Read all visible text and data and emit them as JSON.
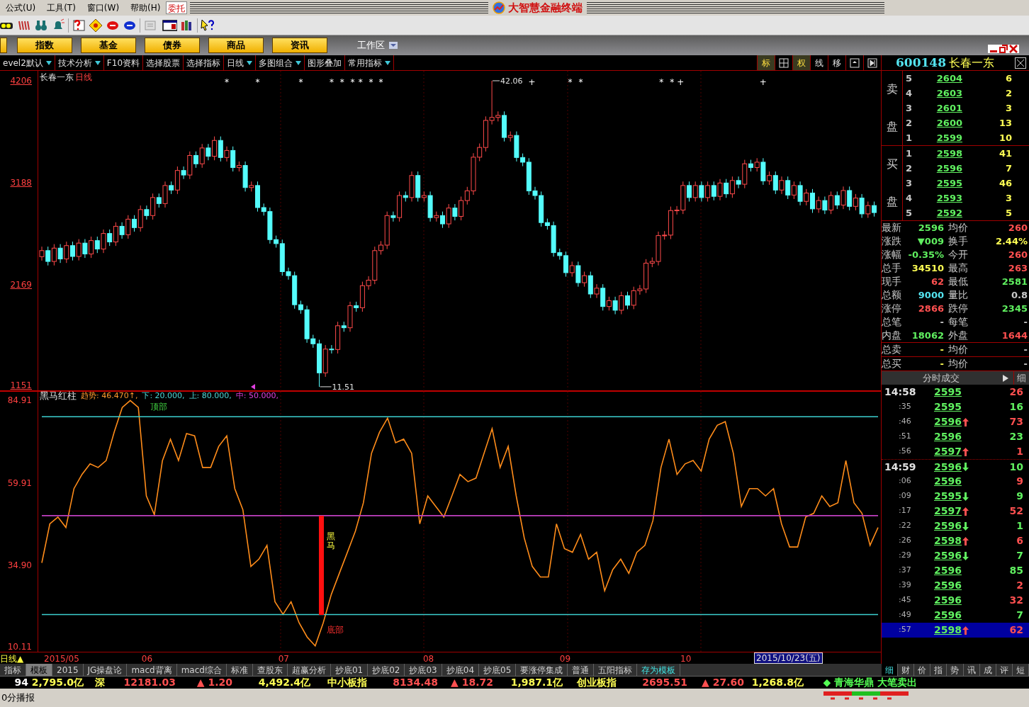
{
  "menu": [
    "公式(U)",
    "工具(T)",
    "窗口(W)",
    "帮助(H)"
  ],
  "entrust_button": "委托",
  "window_title": "大智慧金融终端",
  "market_buttons": [
    "指数",
    "基金",
    "债券",
    "商品",
    "资讯"
  ],
  "workspace": "工作区",
  "tool_row": [
    {
      "label": "evel2默认",
      "dropdown": true
    },
    {
      "label": "技术分析",
      "dropdown": true
    },
    {
      "label": "F10资料",
      "dropdown": false
    },
    {
      "label": "选择股票",
      "dropdown": false
    },
    {
      "label": "选择指标",
      "dropdown": false
    },
    {
      "label": "日线",
      "dropdown": true
    },
    {
      "label": "多图组合",
      "dropdown": true
    },
    {
      "label": "图形叠加",
      "dropdown": false
    },
    {
      "label": "常用指标",
      "dropdown": true
    }
  ],
  "chart_tools": [
    {
      "label": "标",
      "selected": true
    },
    {
      "label": "权",
      "selected": true
    },
    {
      "label": "线",
      "selected": false
    },
    {
      "label": "移",
      "selected": false
    }
  ],
  "stock": {
    "code": "600148",
    "name": "长春一东"
  },
  "price_chart": {
    "stock_name": "长春一东",
    "period": "日线",
    "high_label": "42.06",
    "low_label": "11.51",
    "markers": [
      "*",
      "*",
      "*",
      "*",
      "*",
      "*",
      "*",
      "*",
      "*",
      "+",
      "*",
      "*",
      "*",
      "*",
      "+",
      "+"
    ],
    "chart_data": {
      "type": "candlestick",
      "ylim": [
        1101,
        4305
      ],
      "yticks": [
        {
          "value": 4206,
          "label": "4206"
        },
        {
          "value": 3188,
          "label": "3188"
        },
        {
          "value": 2169,
          "label": "2169"
        },
        {
          "value": 1151,
          "label": "1151"
        }
      ],
      "ohlc": [
        [
          2450,
          2550,
          2410,
          2510
        ],
        [
          2510,
          2550,
          2362,
          2402
        ],
        [
          2402,
          2575,
          2362,
          2535
        ],
        [
          2535,
          2575,
          2387,
          2427
        ],
        [
          2427,
          2600,
          2387,
          2560
        ],
        [
          2560,
          2600,
          2412,
          2452
        ],
        [
          2452,
          2625,
          2412,
          2585
        ],
        [
          2585,
          2625,
          2437,
          2477
        ],
        [
          2477,
          2650,
          2437,
          2610
        ],
        [
          2610,
          2650,
          2486,
          2526
        ],
        [
          2526,
          2721,
          2486,
          2681
        ],
        [
          2681,
          2721,
          2557,
          2597
        ],
        [
          2597,
          2793,
          2557,
          2753
        ],
        [
          2753,
          2793,
          2629,
          2669
        ],
        [
          2669,
          2864,
          2629,
          2824
        ],
        [
          2824,
          2864,
          2700,
          2740
        ],
        [
          2740,
          2960,
          2700,
          2920
        ],
        [
          2920,
          2960,
          2820,
          2860
        ],
        [
          2860,
          3080,
          2820,
          3040
        ],
        [
          3040,
          3080,
          2940,
          2980
        ],
        [
          2980,
          3200,
          2940,
          3160
        ],
        [
          3160,
          3200,
          3075,
          3115
        ],
        [
          3115,
          3350,
          3075,
          3310
        ],
        [
          3310,
          3350,
          3225,
          3265
        ],
        [
          3265,
          3500,
          3225,
          3460
        ],
        [
          3460,
          3500,
          3337,
          3377
        ],
        [
          3377,
          3575,
          3337,
          3535
        ],
        [
          3535,
          3575,
          3412,
          3452
        ],
        [
          3452,
          3650,
          3412,
          3610
        ],
        [
          3610,
          3650,
          3400,
          3440
        ],
        [
          3440,
          3550,
          3400,
          3510
        ],
        [
          3510,
          3550,
          3300,
          3340
        ],
        [
          3340,
          3400,
          3300,
          3360
        ],
        [
          3360,
          3400,
          3100,
          3140
        ],
        [
          3140,
          3200,
          3100,
          3160
        ],
        [
          3160,
          3200,
          2900,
          2940
        ],
        [
          2940,
          2980,
          2860,
          2900
        ],
        [
          2900,
          2940,
          2580,
          2620
        ],
        [
          2620,
          2660,
          2540,
          2580
        ],
        [
          2580,
          2620,
          2260,
          2300
        ],
        [
          2300,
          2340,
          2220,
          2260
        ],
        [
          2260,
          2300,
          1930,
          1970
        ],
        [
          1970,
          2010,
          1880,
          1920
        ],
        [
          1920,
          1960,
          1590,
          1630
        ],
        [
          1630,
          1670,
          1540,
          1580
        ],
        [
          1580,
          1620,
          1151,
          1290
        ],
        [
          1290,
          1567,
          1250,
          1527
        ],
        [
          1527,
          1567,
          1483,
          1523
        ],
        [
          1523,
          1800,
          1483,
          1760
        ],
        [
          1760,
          1800,
          1700,
          1740
        ],
        [
          1740,
          2000,
          1700,
          1960
        ],
        [
          1960,
          2000,
          1900,
          1940
        ],
        [
          1940,
          2200,
          1900,
          2160
        ],
        [
          2160,
          2255,
          2120,
          2215
        ],
        [
          2215,
          2550,
          2175,
          2510
        ],
        [
          2510,
          2605,
          2470,
          2565
        ],
        [
          2565,
          2900,
          2525,
          2860
        ],
        [
          2860,
          2900,
          2800,
          2840
        ],
        [
          2840,
          3100,
          2800,
          3060
        ],
        [
          3060,
          3100,
          3000,
          3040
        ],
        [
          3040,
          3300,
          3000,
          3260
        ],
        [
          3260,
          3300,
          3000,
          3040
        ],
        [
          3040,
          3100,
          3000,
          3060
        ],
        [
          3060,
          3100,
          2800,
          2840
        ],
        [
          2840,
          2900,
          2800,
          2860
        ],
        [
          2860,
          2900,
          2737,
          2777
        ],
        [
          2777,
          2975,
          2737,
          2935
        ],
        [
          2935,
          2975,
          2812,
          2852
        ],
        [
          2852,
          3050,
          2812,
          3010
        ],
        [
          3010,
          3147,
          2970,
          3107
        ],
        [
          3107,
          3483,
          3067,
          3443
        ],
        [
          3443,
          3580,
          3403,
          3540
        ],
        [
          3540,
          3850,
          3500,
          3810
        ],
        [
          3810,
          4206,
          3770,
          3840
        ],
        [
          3840,
          3900,
          3800,
          3860
        ],
        [
          3860,
          3900,
          3600,
          3640
        ],
        [
          3640,
          3700,
          3600,
          3660
        ],
        [
          3660,
          3700,
          3400,
          3440
        ],
        [
          3440,
          3480,
          3353,
          3393
        ],
        [
          3393,
          3433,
          3067,
          3107
        ],
        [
          3107,
          3147,
          3020,
          3060
        ],
        [
          3060,
          3100,
          2750,
          2790
        ],
        [
          2790,
          2830,
          2720,
          2760
        ],
        [
          2760,
          2800,
          2450,
          2490
        ],
        [
          2490,
          2530,
          2420,
          2460
        ],
        [
          2460,
          2500,
          2250,
          2290
        ],
        [
          2290,
          2400,
          2250,
          2360
        ],
        [
          2360,
          2400,
          2150,
          2190
        ],
        [
          2190,
          2300,
          2150,
          2260
        ],
        [
          2260,
          2300,
          2037,
          2077
        ],
        [
          2077,
          2175,
          2037,
          2135
        ],
        [
          2135,
          2175,
          1912,
          1952
        ],
        [
          1952,
          2050,
          1912,
          2010
        ],
        [
          2010,
          2050,
          1875,
          1915
        ],
        [
          1915,
          2100,
          1875,
          2060
        ],
        [
          2060,
          2100,
          1925,
          1965
        ],
        [
          1965,
          2150,
          1925,
          2110
        ],
        [
          2110,
          2167,
          2070,
          2127
        ],
        [
          2127,
          2425,
          2087,
          2385
        ],
        [
          2385,
          2442,
          2345,
          2402
        ],
        [
          2402,
          2700,
          2362,
          2660
        ],
        [
          2660,
          2705,
          2620,
          2665
        ],
        [
          2665,
          2950,
          2625,
          2910
        ],
        [
          2910,
          2955,
          2870,
          2915
        ],
        [
          2915,
          3200,
          2875,
          3160
        ],
        [
          3160,
          3200,
          3000,
          3040
        ],
        [
          3040,
          3200,
          3000,
          3160
        ],
        [
          3160,
          3200,
          3000,
          3040
        ],
        [
          3040,
          3200,
          3000,
          3160
        ],
        [
          3160,
          3200,
          3012,
          3052
        ],
        [
          3052,
          3225,
          3012,
          3185
        ],
        [
          3185,
          3225,
          3037,
          3077
        ],
        [
          3077,
          3250,
          3037,
          3210
        ],
        [
          3210,
          3250,
          3133,
          3173
        ],
        [
          3173,
          3417,
          3133,
          3377
        ],
        [
          3377,
          3417,
          3300,
          3340
        ],
        [
          3340,
          3433,
          3300,
          3393
        ],
        [
          3393,
          3433,
          3167,
          3207
        ],
        [
          3207,
          3300,
          3167,
          3260
        ],
        [
          3260,
          3300,
          3075,
          3115
        ],
        [
          3115,
          3250,
          3075,
          3210
        ],
        [
          3210,
          3250,
          3025,
          3065
        ],
        [
          3065,
          3200,
          3025,
          3160
        ],
        [
          3160,
          3200,
          2962,
          3002
        ],
        [
          3002,
          3125,
          2962,
          3085
        ],
        [
          3085,
          3125,
          2887,
          2927
        ],
        [
          2927,
          3050,
          2887,
          3010
        ],
        [
          3010,
          3050,
          2875,
          2915
        ],
        [
          2915,
          3100,
          2875,
          3060
        ],
        [
          3060,
          3100,
          2925,
          2965
        ],
        [
          2965,
          3150,
          2925,
          3110
        ],
        [
          3110,
          3150,
          2912,
          2952
        ],
        [
          2952,
          3075,
          2912,
          3035
        ],
        [
          3035,
          3075,
          2837,
          2877
        ],
        [
          2877,
          3000,
          2837,
          2960
        ],
        [
          2960,
          3000,
          2850,
          2890
        ]
      ]
    }
  },
  "indicator": {
    "name": "黑马红柱",
    "legend": [
      {
        "text": "趋势: 46.470↑,",
        "color": "#ff9a2e"
      },
      {
        "text": "下: 20.000,",
        "color": "#4fd8d8"
      },
      {
        "text": "上: 80.000,",
        "color": "#4fd8d8"
      },
      {
        "text": "中: 50.000,",
        "color": "#e040e0"
      }
    ],
    "chart_data": {
      "type": "line",
      "ylim": [
        8.73,
        87.57
      ],
      "yticks": [
        {
          "value": 84.91,
          "label": "84.91"
        },
        {
          "value": 59.91,
          "label": "59.91"
        },
        {
          "value": 34.9,
          "label": "34.90"
        },
        {
          "value": 10.11,
          "label": "10.11"
        }
      ],
      "categories": [
        null,
        null,
        null,
        null,
        null,
        null,
        null,
        null,
        null,
        null,
        null,
        null,
        null,
        "06",
        null,
        null,
        null,
        null,
        null,
        null,
        null,
        null,
        null,
        null,
        null,
        null,
        null,
        null,
        null,
        null,
        "07",
        null,
        null,
        null,
        null,
        null,
        null,
        null,
        null,
        null,
        null,
        null,
        null,
        null,
        null,
        null,
        null,
        null,
        "08",
        null,
        null,
        null,
        null,
        null,
        null,
        null,
        null,
        null,
        null,
        null,
        null,
        null,
        null,
        null,
        null,
        "09",
        null,
        null,
        null,
        null,
        null,
        null,
        null,
        null,
        null,
        null,
        null,
        null,
        null,
        null,
        "10",
        null,
        null,
        null,
        null,
        null,
        null,
        null,
        null,
        null,
        null,
        null,
        null,
        null,
        null,
        null,
        null,
        null,
        null,
        null,
        null,
        null,
        null,
        null,
        null
      ],
      "series": [
        {
          "color": "#ff8c1a",
          "values": [
            35.7,
            47.5,
            49.6,
            46.4,
            58.2,
            62.5,
            65.7,
            64.6,
            66.7,
            75.3,
            82.8,
            84.9,
            82.8,
            56.0,
            50.3,
            66.7,
            73.2,
            66.7,
            74.9,
            74.2,
            64.6,
            64.6,
            71.0,
            74.2,
            58.2,
            51.8,
            34.6,
            36.8,
            41.0,
            23.9,
            20.1,
            23.9,
            17.5,
            13.2,
            10.5,
            17.5,
            26.1,
            32.5,
            38.9,
            45.3,
            53.9,
            68.9,
            75.3,
            79.6,
            72.1,
            73.2,
            68.9,
            47.5,
            56.0,
            52.8,
            49.6,
            56.0,
            62.5,
            60.3,
            61.4,
            68.9,
            76.4,
            64.6,
            71.0,
            56.0,
            43.2,
            34.6,
            31.4,
            31.4,
            47.5,
            40.0,
            38.9,
            44.3,
            36.8,
            38.9,
            27.2,
            33.6,
            36.8,
            32.5,
            38.9,
            41.0,
            48.5,
            64.6,
            73.2,
            62.5,
            65.7,
            66.7,
            63.5,
            73.2,
            77.4,
            78.5,
            68.9,
            52.8,
            58.2,
            58.2,
            56.0,
            58.2,
            47.5,
            40.5,
            40.5,
            49.6,
            50.7,
            56.0,
            52.8,
            53.9,
            66.7,
            53.9,
            50.7,
            41.0,
            46.4
          ]
        },
        {
          "color": "#3cd0d0",
          "values": [
            20,
            20,
            20,
            20,
            20,
            20,
            20,
            20,
            20,
            20,
            20,
            20,
            20,
            20,
            20,
            20,
            20,
            20,
            20,
            20,
            20,
            20,
            20,
            20,
            20,
            20,
            20,
            20,
            20,
            20,
            20,
            20,
            20,
            20,
            20,
            20,
            20,
            20,
            20,
            20,
            20,
            20,
            20,
            20,
            20,
            20,
            20,
            20,
            20,
            20,
            20,
            20,
            20,
            20,
            20,
            20,
            20,
            20,
            20,
            20,
            20,
            20,
            20,
            20,
            20,
            20,
            20,
            20,
            20,
            20,
            20,
            20,
            20,
            20,
            20,
            20,
            20,
            20,
            20,
            20,
            20,
            20,
            20,
            20,
            20,
            20,
            20,
            20,
            20,
            20,
            20,
            20,
            20,
            20,
            20,
            20,
            20,
            20,
            20,
            20,
            20,
            20,
            20,
            20,
            20
          ]
        },
        {
          "color": "#3cd0d0",
          "values": [
            80,
            80,
            80,
            80,
            80,
            80,
            80,
            80,
            80,
            80,
            80,
            80,
            80,
            80,
            80,
            80,
            80,
            80,
            80,
            80,
            80,
            80,
            80,
            80,
            80,
            80,
            80,
            80,
            80,
            80,
            80,
            80,
            80,
            80,
            80,
            80,
            80,
            80,
            80,
            80,
            80,
            80,
            80,
            80,
            80,
            80,
            80,
            80,
            80,
            80,
            80,
            80,
            80,
            80,
            80,
            80,
            80,
            80,
            80,
            80,
            80,
            80,
            80,
            80,
            80,
            80,
            80,
            80,
            80,
            80,
            80,
            80,
            80,
            80,
            80,
            80,
            80,
            80,
            80,
            80,
            80,
            80,
            80,
            80,
            80,
            80,
            80,
            80,
            80,
            80,
            80,
            80,
            80,
            80,
            80,
            80,
            80,
            80,
            80,
            80,
            80,
            80,
            80,
            80,
            80
          ]
        },
        {
          "color": "#c040c0",
          "values": [
            50,
            50,
            50,
            50,
            50,
            50,
            50,
            50,
            50,
            50,
            50,
            50,
            50,
            50,
            50,
            50,
            50,
            50,
            50,
            50,
            50,
            50,
            50,
            50,
            50,
            50,
            50,
            50,
            50,
            50,
            50,
            50,
            50,
            50,
            50,
            50,
            50,
            50,
            50,
            50,
            50,
            50,
            50,
            50,
            50,
            50,
            50,
            50,
            50,
            50,
            50,
            50,
            50,
            50,
            50,
            50,
            50,
            50,
            50,
            50,
            50,
            50,
            50,
            50,
            50,
            50,
            50,
            50,
            50,
            50,
            50,
            50,
            50,
            50,
            50,
            50,
            50,
            50,
            50,
            50,
            50,
            50,
            50,
            50,
            50,
            50,
            50,
            50,
            50,
            50,
            50,
            50,
            50,
            50,
            50,
            50,
            50,
            50,
            50,
            50,
            50,
            50,
            50,
            50,
            50
          ]
        }
      ],
      "annotations": [
        "顶部",
        "黑马",
        "底部"
      ]
    }
  },
  "x_axis": {
    "period": "日线▲",
    "start_label": "2015/05",
    "cursor_date": "2015/10/23(五)"
  },
  "indicator_tabs": [
    {
      "label": "指标",
      "selected": false
    },
    {
      "label": "模板",
      "selected": true
    },
    {
      "label": "2015",
      "selected": false
    },
    {
      "label": "JG操盘论",
      "selected": false
    },
    {
      "label": "macd背离",
      "selected": false
    },
    {
      "label": "macd综合",
      "selected": false
    },
    {
      "label": "标准",
      "selected": false
    },
    {
      "label": "查股东",
      "selected": false
    },
    {
      "label": "超赢分析",
      "selected": false
    },
    {
      "label": "抄底01",
      "selected": false
    },
    {
      "label": "抄底02",
      "selected": false
    },
    {
      "label": "抄底03",
      "selected": false
    },
    {
      "label": "抄底04",
      "selected": false
    },
    {
      "label": "抄底05",
      "selected": false
    },
    {
      "label": "要涨停集成",
      "selected": false
    },
    {
      "label": "普通",
      "selected": false
    },
    {
      "label": "五阳指标",
      "selected": false
    },
    {
      "label": "存为模板",
      "selected": false
    }
  ],
  "order_book": {
    "sell_label": [
      "卖",
      "盘"
    ],
    "buy_label": [
      "买",
      "盘"
    ],
    "sell": [
      {
        "rank": "5",
        "price": "2604",
        "volume": "6"
      },
      {
        "rank": "4",
        "price": "2603",
        "volume": "2"
      },
      {
        "rank": "3",
        "price": "2601",
        "volume": "3"
      },
      {
        "rank": "2",
        "price": "2600",
        "volume": "13"
      },
      {
        "rank": "1",
        "price": "2599",
        "volume": "10"
      }
    ],
    "buy": [
      {
        "rank": "1",
        "price": "2598",
        "volume": "41"
      },
      {
        "rank": "2",
        "price": "2596",
        "volume": "7"
      },
      {
        "rank": "3",
        "price": "2595",
        "volume": "46"
      },
      {
        "rank": "4",
        "price": "2593",
        "volume": "3"
      },
      {
        "rank": "5",
        "price": "2592",
        "volume": "5"
      }
    ]
  },
  "stats": [
    {
      "left": {
        "label": "最新",
        "value": "2596",
        "color": "#60f060"
      },
      "right": {
        "label": "均价",
        "value": "260",
        "color": "#ff5050"
      }
    },
    {
      "left": {
        "label": "涨跌",
        "value": "▼009",
        "color": "#60f060"
      },
      "right": {
        "label": "换手",
        "value": "2.44%",
        "color": "#ffff54"
      }
    },
    {
      "left": {
        "label": "涨幅",
        "value": "-0.35%",
        "color": "#60f060"
      },
      "right": {
        "label": "今开",
        "value": "260",
        "color": "#ff5050"
      }
    },
    {
      "left": {
        "label": "总手",
        "value": "34510",
        "color": "#ffff54"
      },
      "right": {
        "label": "最高",
        "value": "263",
        "color": "#ff5050"
      }
    },
    {
      "left": {
        "label": "现手",
        "value": "62",
        "color": "#ff5050"
      },
      "right": {
        "label": "最低",
        "value": "2581",
        "color": "#60f060"
      }
    },
    {
      "left": {
        "label": "总额",
        "value": "9000",
        "color": "#54e4f0"
      },
      "right": {
        "label": "量比",
        "value": "0.8",
        "color": "#c8c8c8"
      }
    },
    {
      "left": {
        "label": "涨停",
        "value": "2866",
        "color": "#ff5050"
      },
      "right": {
        "label": "跌停",
        "value": "2345",
        "color": "#60f060"
      }
    },
    {
      "left": {
        "label": "总笔",
        "value": "-",
        "color": "#c8c8c8"
      },
      "right": {
        "label": "每笔",
        "value": "-",
        "color": "#c8c8c8"
      }
    },
    {
      "left": {
        "label": "内盘",
        "value": "18062",
        "color": "#60f060"
      },
      "right": {
        "label": "外盘",
        "value": "1644",
        "color": "#ff5050"
      }
    },
    {
      "left": {
        "label": "总卖",
        "value": "-",
        "color": "#ffff54"
      },
      "right": {
        "label": "均价",
        "value": "-",
        "color": "#c8c8c8"
      }
    },
    {
      "left": {
        "label": "总买",
        "value": "-",
        "color": "#ffff54"
      },
      "right": {
        "label": "均价",
        "value": "-",
        "color": "#c8c8c8"
      }
    }
  ],
  "trades_header": {
    "title": "分时成交",
    "detail": "细"
  },
  "trades": [
    {
      "time": "14:58",
      "kind": "minute",
      "price": "2595",
      "up": false,
      "down": false,
      "volume": "26",
      "buy": true,
      "selected": false
    },
    {
      "time": ":35",
      "kind": "second",
      "price": "2595",
      "up": false,
      "down": false,
      "volume": "16",
      "buy": false,
      "selected": false
    },
    {
      "time": ":46",
      "kind": "second",
      "price": "2596",
      "up": true,
      "down": false,
      "volume": "73",
      "buy": true,
      "selected": false
    },
    {
      "time": ":51",
      "kind": "second",
      "price": "2596",
      "up": false,
      "down": false,
      "volume": "23",
      "buy": false,
      "selected": false
    },
    {
      "time": ":56",
      "kind": "second",
      "price": "2597",
      "up": true,
      "down": false,
      "volume": "1",
      "buy": true,
      "selected": false
    },
    {
      "time": "14:59",
      "kind": "minute",
      "price": "2596",
      "up": false,
      "down": true,
      "volume": "10",
      "buy": false,
      "selected": false
    },
    {
      "time": ":06",
      "kind": "second",
      "price": "2596",
      "up": false,
      "down": false,
      "volume": "9",
      "buy": true,
      "selected": false
    },
    {
      "time": ":09",
      "kind": "second",
      "price": "2595",
      "up": false,
      "down": true,
      "volume": "9",
      "buy": false,
      "selected": false
    },
    {
      "time": ":17",
      "kind": "second",
      "price": "2597",
      "up": true,
      "down": false,
      "volume": "52",
      "buy": true,
      "selected": false
    },
    {
      "time": ":22",
      "kind": "second",
      "price": "2596",
      "up": false,
      "down": true,
      "volume": "1",
      "buy": false,
      "selected": false
    },
    {
      "time": ":26",
      "kind": "second",
      "price": "2598",
      "up": true,
      "down": false,
      "volume": "6",
      "buy": true,
      "selected": false
    },
    {
      "time": ":29",
      "kind": "second",
      "price": "2596",
      "up": false,
      "down": true,
      "volume": "7",
      "buy": false,
      "selected": false
    },
    {
      "time": ":37",
      "kind": "second",
      "price": "2596",
      "up": false,
      "down": false,
      "volume": "85",
      "buy": false,
      "selected": false
    },
    {
      "time": ":39",
      "kind": "second",
      "price": "2596",
      "up": false,
      "down": false,
      "volume": "2",
      "buy": true,
      "selected": false
    },
    {
      "time": ":45",
      "kind": "second",
      "price": "2596",
      "up": false,
      "down": false,
      "volume": "32",
      "buy": true,
      "selected": false
    },
    {
      "time": ":49",
      "kind": "second",
      "price": "2596",
      "up": false,
      "down": false,
      "volume": "7",
      "buy": false,
      "selected": false
    },
    {
      "time": ":57",
      "kind": "second",
      "price": "2598",
      "up": true,
      "down": false,
      "volume": "62",
      "buy": true,
      "selected": true
    }
  ],
  "panel_tabs": [
    {
      "label": "细",
      "selected": true
    },
    {
      "label": "财",
      "selected": false
    },
    {
      "label": "价",
      "selected": false
    },
    {
      "label": "指",
      "selected": false
    },
    {
      "label": "势",
      "selected": false
    },
    {
      "label": "讯",
      "selected": false
    },
    {
      "label": "成",
      "selected": false
    },
    {
      "label": "评",
      "selected": false
    },
    {
      "label": "短",
      "selected": false
    }
  ],
  "ticker": [
    {
      "text": "94",
      "kind": "cut"
    },
    {
      "text": "2,795.0亿",
      "kind": "amount"
    },
    {
      "text": "深",
      "kind": "name"
    },
    {
      "text": "12181.03",
      "kind": "index"
    },
    {
      "text": "▲ 1.20",
      "kind": "change"
    },
    {
      "text": "4,492.4亿",
      "kind": "amount"
    },
    {
      "text": "中小板指",
      "kind": "name"
    },
    {
      "text": "8134.48",
      "kind": "index"
    },
    {
      "text": "▲ 18.72",
      "kind": "change"
    },
    {
      "text": "1,987.1亿",
      "kind": "amount"
    },
    {
      "text": "创业板指",
      "kind": "name"
    },
    {
      "text": "2695.51",
      "kind": "index"
    },
    {
      "text": "▲ 27.60",
      "kind": "change"
    },
    {
      "text": "1,268.8亿",
      "kind": "amount"
    },
    {
      "text": "◆ 青海华鼎 大笔卖出",
      "kind": "alert"
    }
  ],
  "status": "0分播报"
}
